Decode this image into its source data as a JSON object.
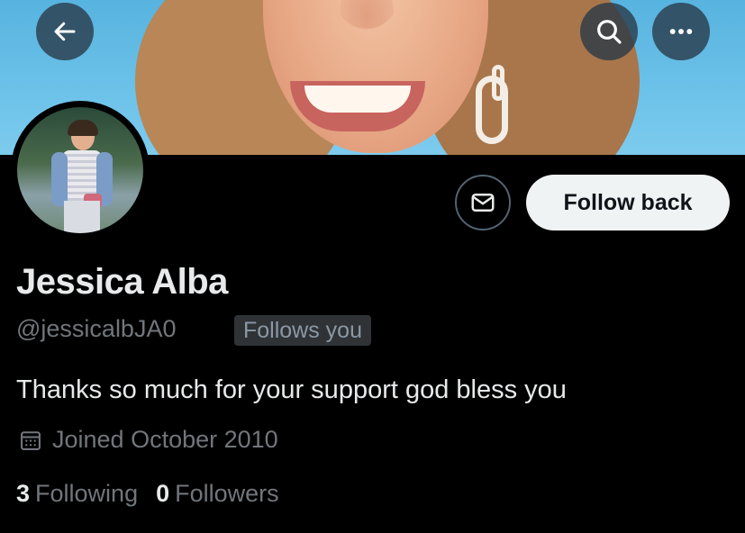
{
  "header": {
    "back_icon": "arrow-left-icon",
    "search_icon": "search-icon",
    "more_icon": "more-horizontal-icon"
  },
  "profile": {
    "name": "Jessica Alba",
    "handle": "@jessicalbJA0",
    "follows_you_badge": "Follows you",
    "bio": "Thanks so much for your support god bless you",
    "joined": "Joined October 2010",
    "following_count": "3",
    "following_label": "Following",
    "followers_count": "0",
    "followers_label": "Followers"
  },
  "actions": {
    "message_icon": "mail-icon",
    "follow_label": "Follow back"
  },
  "colors": {
    "background": "#000000",
    "primary_text": "#e7e9ea",
    "secondary_text": "#71767b",
    "button_light": "#eff3f4"
  }
}
